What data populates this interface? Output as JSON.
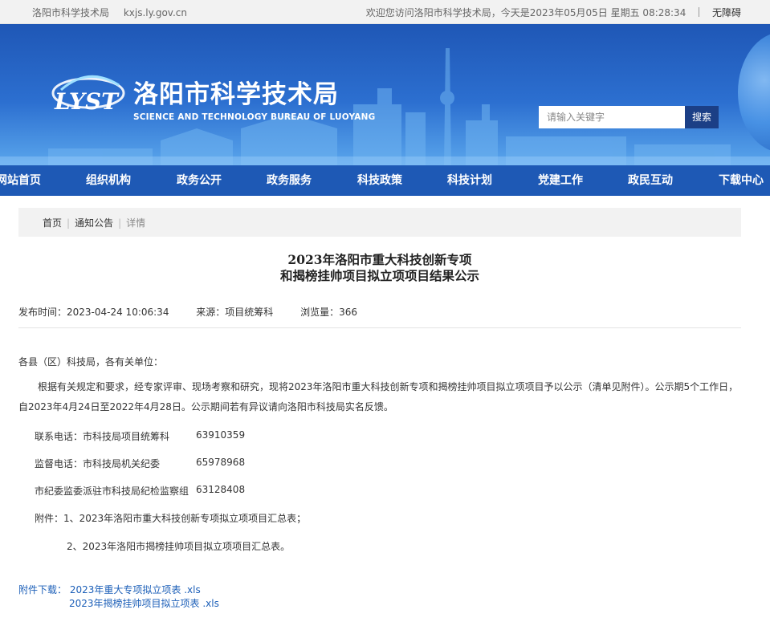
{
  "topbar": {
    "site_name": "洛阳市科学技术局",
    "domain": "kxjs.ly.gov.cn",
    "welcome": "欢迎您访问洛阳市科学技术局，今天是2023年05月05日 星期五 08:28:34",
    "accessibility": "无障碍"
  },
  "header": {
    "logo_mark": "LYST",
    "title_cn": "洛阳市科学技术局",
    "title_en": "SCIENCE AND TECHNOLOGY BUREAU OF LUOYANG",
    "search_placeholder": "请输入关键字",
    "search_button": "搜索"
  },
  "nav": {
    "items": [
      {
        "label": "网站首页"
      },
      {
        "label": "组织机构"
      },
      {
        "label": "政务公开"
      },
      {
        "label": "政务服务"
      },
      {
        "label": "科技政策"
      },
      {
        "label": "科技计划"
      },
      {
        "label": "党建工作"
      },
      {
        "label": "政民互动"
      },
      {
        "label": "下载中心"
      }
    ]
  },
  "breadcrumb": {
    "items": [
      "首页",
      "通知公告",
      "详情"
    ]
  },
  "article": {
    "title_line1": "2023年洛阳市重大科技创新专项",
    "title_line2": "和揭榜挂帅项目拟立项项目结果公示",
    "publish_time": "发布时间：2023-04-24 10:06:34",
    "source": "来源：项目统筹科",
    "views": "浏览量：366",
    "salutation": "各县（区）科技局，各有关单位：",
    "body": "根据有关规定和要求，经专家评审、现场考察和研究，现将2023年洛阳市重大科技创新专项和揭榜挂帅项目拟立项项目予以公示（清单见附件）。公示期5个工作日，自2023年4月24日至2022年4月28日。公示期间若有异议请向洛阳市科技局实名反馈。",
    "contacts": [
      {
        "label": "联系电话：市科技局项目统筹科",
        "number": "63910359"
      },
      {
        "label": "监督电话：市科技局机关纪委",
        "number": "65978968"
      },
      {
        "label": "市纪委监委派驻市科技局纪检监察组",
        "number": "63128408"
      }
    ],
    "attachment_1": "附件：1、2023年洛阳市重大科技创新专项拟立项项目汇总表；",
    "attachment_2": "2、2023年洛阳市揭榜挂帅项目拟立项项目汇总表。"
  },
  "downloads": {
    "label": "附件下载：",
    "files": [
      "2023年重大专项拟立项表 .xls",
      "2023年揭榜挂帅项目拟立项表 .xls"
    ]
  }
}
